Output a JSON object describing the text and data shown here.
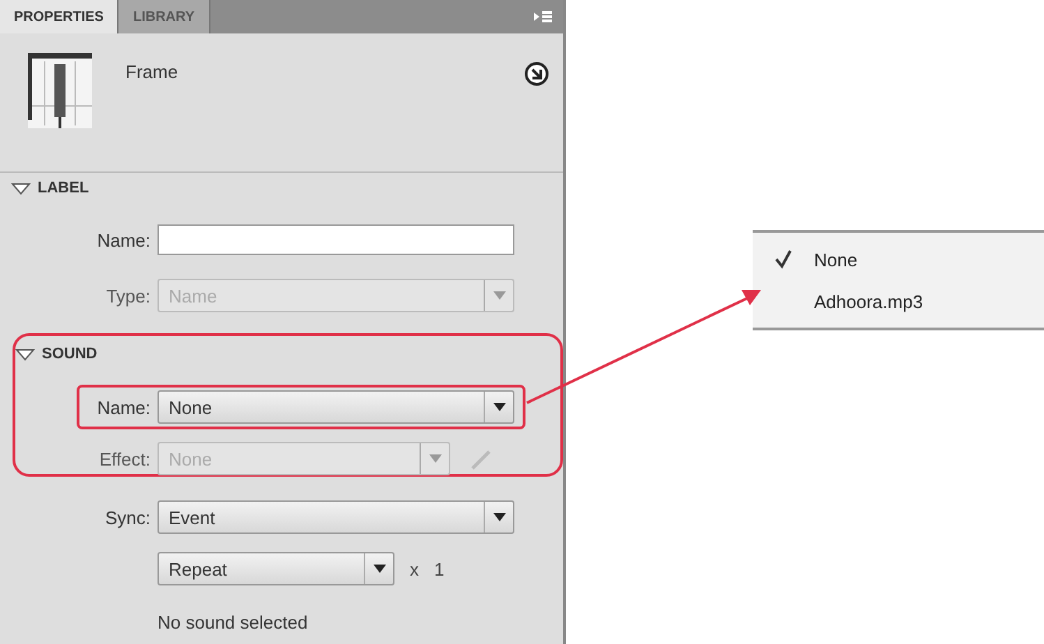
{
  "tabs": [
    {
      "label": "PROPERTIES",
      "selected": true
    },
    {
      "label": "LIBRARY",
      "selected": false
    }
  ],
  "header": {
    "title": "Frame"
  },
  "sections": [
    {
      "title": "LABEL",
      "expanded": true,
      "rows": [
        {
          "kind": "text",
          "label": "Name:",
          "disabled": false
        },
        {
          "kind": "dropdown",
          "label": "Type:",
          "value": "Name",
          "disabled": true
        }
      ]
    },
    {
      "title": "SOUND",
      "expanded": true,
      "highlight_frame": {
        "pointer_row": {
          "kind": "dropdown",
          "label": "Name:",
          "value": "None",
          "disabled": false
        },
        "rows": [
          {
            "kind": "dropdown-edit",
            "label": "Effect:",
            "value": "None",
            "disabled": true
          }
        ]
      },
      "rows": [
        {
          "kind": "dropdown",
          "label": "Sync:",
          "value": "Event",
          "disabled": false
        },
        {
          "kind": "repeat",
          "value": "Repeat",
          "times": "x",
          "count": "1",
          "disabled": false
        },
        {
          "kind": "note",
          "text": "No sound selected"
        }
      ]
    }
  ],
  "sound_menu": {
    "items": [
      {
        "label": "None",
        "checked": true
      },
      {
        "label": "Adhoora.mp3",
        "checked": false
      }
    ]
  }
}
